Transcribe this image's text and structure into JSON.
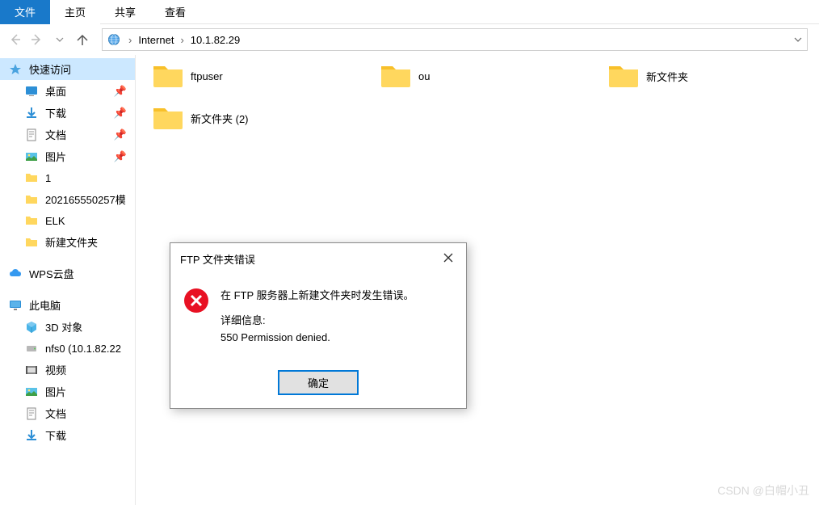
{
  "ribbon": {
    "file": "文件",
    "home": "主页",
    "share": "共享",
    "view": "查看"
  },
  "breadcrumb": {
    "root": "Internet",
    "path": "10.1.82.29"
  },
  "sidebar": {
    "quick_access": "快速访问",
    "desktop": "桌面",
    "downloads": "下载",
    "documents": "文档",
    "pictures": "图片",
    "item1": "1",
    "item_long": "202165550257模",
    "elk": "ELK",
    "new_folder": "新建文件夹",
    "wps": "WPS云盘",
    "this_pc": "此电脑",
    "objects3d": "3D 对象",
    "nfs0": "nfs0 (10.1.82.22",
    "videos": "视频",
    "pictures2": "图片",
    "documents2": "文档",
    "downloads2": "下载"
  },
  "files": [
    {
      "name": "ftpuser"
    },
    {
      "name": "ou"
    },
    {
      "name": "新文件夹"
    },
    {
      "name": "新文件夹 (2)"
    }
  ],
  "dialog": {
    "title": "FTP 文件夹错误",
    "message": "在 FTP 服务器上新建文件夹时发生错误。",
    "details_label": "详细信息:",
    "details": "550 Permission denied.",
    "ok": "确定"
  },
  "watermark": "CSDN @白帽小丑"
}
